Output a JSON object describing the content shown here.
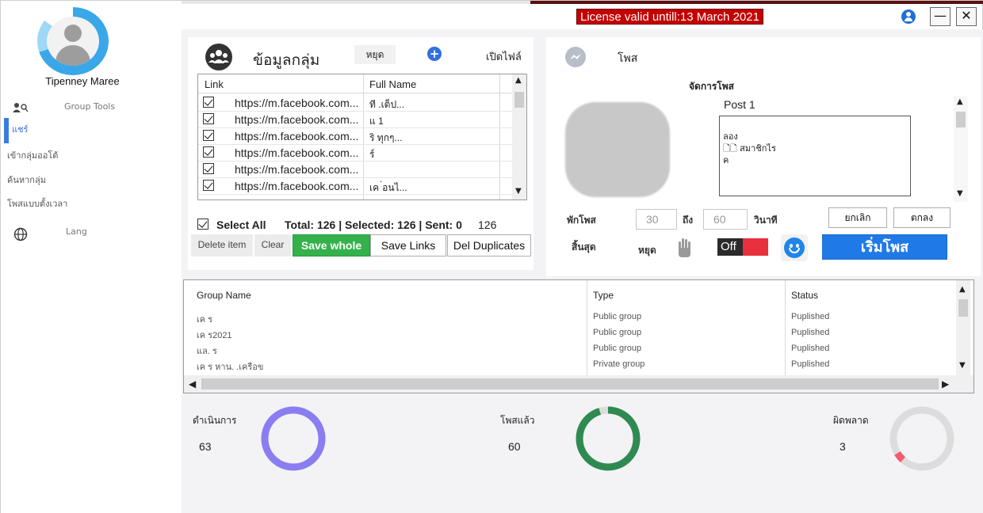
{
  "window": {
    "license": "License valid untill:13 March 2021",
    "minimize": "—",
    "close": "✕"
  },
  "sidebar": {
    "username": "Tipenney Maree",
    "section_label": "Group Tools",
    "items": [
      {
        "label": "แชร์"
      },
      {
        "label": "เข้ากลุ่มออโต้"
      },
      {
        "label": "ค้นหากลุ่ม"
      },
      {
        "label": "โพสแบบตั้งเวลา"
      }
    ],
    "lang_label": "Lang"
  },
  "group_panel": {
    "title": "ข้อมูลกลุ่ม",
    "stop_label": "หยุด",
    "open_file_label": "เปิดไฟล์",
    "columns": [
      "Link",
      "Full Name"
    ],
    "rows": [
      {
        "link": "https://m.facebook.com...",
        "name": "ที                         .เต็ป..."
      },
      {
        "link": "https://m.facebook.com...",
        "name": "แ                  1"
      },
      {
        "link": "https://m.facebook.com...",
        "name": "                       ริ ทุกๆ..."
      },
      {
        "link": "https://m.facebook.com...",
        "name": "           ร์"
      },
      {
        "link": "https://m.facebook.com...",
        "name": ""
      },
      {
        "link": "https://m.facebook.com...",
        "name": "เค                   ่อนไ..."
      }
    ],
    "select_all": "Select All",
    "summary": "Total: 126  | Selected: 126 | Sent: 0",
    "summary_count": "126",
    "buttons": {
      "delete_item": "Delete item",
      "clear": "Clear",
      "save_whole": "Save whole",
      "save_links": "Save Links",
      "del_duplicates": "Del Duplicates"
    }
  },
  "post_panel": {
    "title": "โพส",
    "manage_label": "จัดการโพส",
    "post_label": "Post  1",
    "post_text_lines": [
      "ลอง",
      "🗋🗋 สมาชิกไร",
      "ค"
    ],
    "pause_label": "พักโพส",
    "pause_from": "30",
    "to_label": "ถึง",
    "pause_to": "60",
    "seconds_label": "วินาที",
    "cancel_label": "ยกเลิก",
    "ok_label": "ตกลง",
    "end_label": "สิ้นสุด",
    "stop_label": "หยุด",
    "toggle_label": "Off",
    "start_label": "เริ่มโพส"
  },
  "group_table": {
    "columns": [
      "Group Name",
      "Type",
      "Status"
    ],
    "rows": [
      {
        "name": "เค       ร",
        "type": "Public group",
        "status": "Puplished"
      },
      {
        "name": "เค      ร2021",
        "type": "Public group",
        "status": "Puplished"
      },
      {
        "name": "แล.       ร",
        "type": "Public group",
        "status": "Puplished"
      },
      {
        "name": "เค     ร     หาน.     .เครือข",
        "type": "Private group",
        "status": "Puplished"
      }
    ]
  },
  "stats": [
    {
      "label": "ดำเนินการ",
      "value": "63",
      "color": "#8a7df2",
      "fraction": 1.0
    },
    {
      "label": "โพสแล้ว",
      "value": "60",
      "color": "#2f8a52",
      "fraction": 0.952
    },
    {
      "label": "ผิดพลาด",
      "value": "3",
      "color": "#f25a6e",
      "fraction": 0.048
    }
  ]
}
